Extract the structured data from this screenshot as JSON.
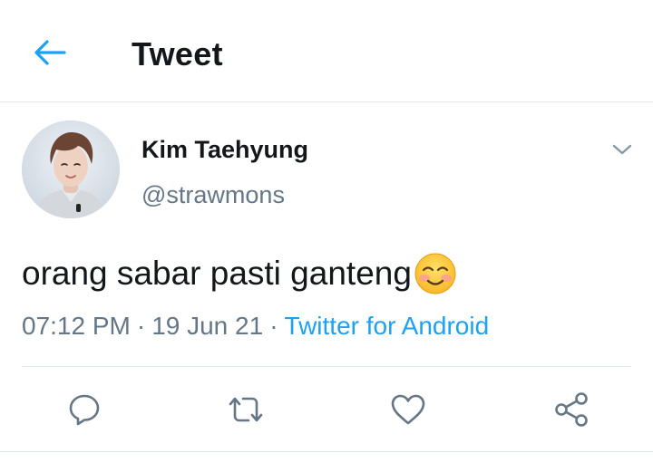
{
  "colors": {
    "accent": "#1da1f2",
    "text": "#14171a",
    "secondary_text": "#657786",
    "icon": "#657786",
    "border": "#e1e8ed"
  },
  "header": {
    "back_icon": "arrow-left-icon",
    "title": "Tweet"
  },
  "tweet": {
    "author": {
      "display_name": "Kim Taehyung",
      "handle": "@strawmons",
      "avatar": "avatar-photo"
    },
    "menu_icon": "chevron-down-icon",
    "text": "orang sabar pasti ganteng",
    "emoji_icon": "smiling-face-emoji",
    "time": "07:12 PM",
    "separator": "·",
    "date": "19 Jun 21",
    "source": "Twitter for Android"
  },
  "actions": [
    {
      "name": "reply",
      "icon": "reply-icon"
    },
    {
      "name": "retweet",
      "icon": "retweet-icon"
    },
    {
      "name": "like",
      "icon": "heart-icon"
    },
    {
      "name": "share",
      "icon": "share-icon"
    }
  ]
}
